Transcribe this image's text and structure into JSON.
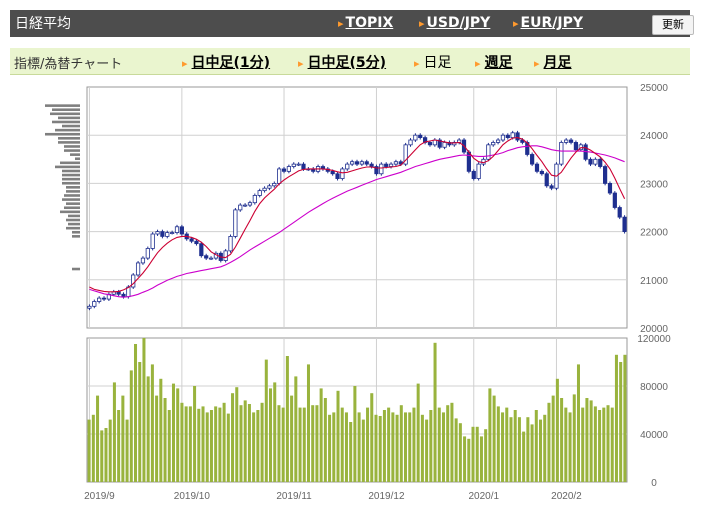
{
  "header": {
    "title": "日経平均",
    "links": [
      "TOPIX",
      "USD/JPY",
      "EUR/JPY"
    ],
    "refresh_label": "更新"
  },
  "tabs": {
    "label": "指標/為替チャート",
    "items": [
      {
        "label": "日中足(1分)",
        "active": false
      },
      {
        "label": "日中足(5分)",
        "active": false
      },
      {
        "label": "日足",
        "active": true
      },
      {
        "label": "週足",
        "active": false
      },
      {
        "label": "月足",
        "active": false
      }
    ]
  },
  "colors": {
    "accent": "#ff9a2e",
    "up_candle": "#ffffff",
    "down_candle": "#1f2f8f",
    "ma_short": "#cc0033",
    "ma_long": "#cc00cc",
    "volume_bar": "#99b33d",
    "volume_profile": "#7f7f7f"
  },
  "chart_data": [
    {
      "type": "candlestick",
      "title": "",
      "ylim": [
        20000,
        25000
      ],
      "yticks": [
        20000,
        21000,
        22000,
        23000,
        24000,
        25000
      ],
      "xticks": [
        {
          "label": "2019/9",
          "index": 0
        },
        {
          "label": "2019/10",
          "index": 19
        },
        {
          "label": "2019/11",
          "index": 40
        },
        {
          "label": "2019/12",
          "index": 59
        },
        {
          "label": "2020/1",
          "index": 79
        },
        {
          "label": "2020/2",
          "index": 96
        }
      ],
      "close": [
        20450,
        20550,
        20620,
        20600,
        20700,
        20750,
        20700,
        20650,
        20850,
        21100,
        21350,
        21450,
        21650,
        21950,
        22000,
        21900,
        21980,
        21980,
        22100,
        21950,
        21850,
        21800,
        21750,
        21500,
        21450,
        21450,
        21550,
        21400,
        21600,
        21900,
        22450,
        22550,
        22550,
        22600,
        22750,
        22850,
        22900,
        22950,
        23000,
        23300,
        23250,
        23350,
        23400,
        23400,
        23300,
        23300,
        23250,
        23350,
        23300,
        23250,
        23200,
        23100,
        23300,
        23400,
        23450,
        23400,
        23450,
        23400,
        23350,
        23200,
        23400,
        23350,
        23400,
        23450,
        23400,
        23800,
        23900,
        24000,
        23950,
        23850,
        23800,
        23900,
        23750,
        23850,
        23800,
        23850,
        23900,
        23650,
        23250,
        23100,
        23400,
        23500,
        23800,
        23850,
        23900,
        24000,
        23950,
        24050,
        23900,
        23850,
        23600,
        23400,
        23250,
        23200,
        22950,
        22900,
        23400,
        23850,
        23900,
        23850,
        23700,
        23800,
        23500,
        23400,
        23500,
        23350,
        23000,
        22800,
        22500,
        22300,
        22000
      ],
      "series": [
        {
          "name": "",
          "values": [
            20850,
            20800,
            20780,
            20760,
            20750,
            20750,
            20760,
            20790,
            20840,
            20920,
            21030,
            21140,
            21270,
            21420,
            21560,
            21670,
            21760,
            21830,
            21880,
            21900,
            21900,
            21880,
            21840,
            21780,
            21690,
            21580,
            21520,
            21470,
            21460,
            21530,
            21680,
            21860,
            22050,
            22230,
            22420,
            22580,
            22700,
            22790,
            22880,
            22990,
            23070,
            23140,
            23200,
            23260,
            23290,
            23300,
            23300,
            23300,
            23300,
            23290,
            23270,
            23240,
            23220,
            23230,
            23260,
            23290,
            23320,
            23340,
            23340,
            23320,
            23320,
            23330,
            23340,
            23350,
            23380,
            23480,
            23590,
            23700,
            23800,
            23860,
            23880,
            23900,
            23880,
            23860,
            23840,
            23840,
            23850,
            23780,
            23650,
            23520,
            23450,
            23430,
            23470,
            23560,
            23680,
            23800,
            23880,
            23940,
            23950,
            23920,
            23840,
            23720,
            23580,
            23450,
            23300,
            23170,
            23150,
            23230,
            23380,
            23530,
            23650,
            23740,
            23740,
            23690,
            23620,
            23550,
            23440,
            23300,
            23110,
            22890,
            22680
          ]
        },
        {
          "name": "",
          "values": [
            20800,
            20770,
            20740,
            20710,
            20690,
            20670,
            20650,
            20640,
            20650,
            20670,
            20700,
            20740,
            20780,
            20830,
            20890,
            20940,
            20990,
            21030,
            21070,
            21100,
            21130,
            21150,
            21170,
            21190,
            21210,
            21230,
            21250,
            21270,
            21310,
            21360,
            21420,
            21480,
            21550,
            21620,
            21680,
            21740,
            21800,
            21860,
            21920,
            21980,
            22050,
            22120,
            22190,
            22260,
            22330,
            22400,
            22460,
            22520,
            22580,
            22640,
            22690,
            22740,
            22790,
            22840,
            22880,
            22920,
            22960,
            23000,
            23040,
            23080,
            23110,
            23140,
            23170,
            23200,
            23230,
            23270,
            23310,
            23350,
            23380,
            23410,
            23440,
            23470,
            23500,
            23520,
            23540,
            23560,
            23580,
            23590,
            23580,
            23570,
            23560,
            23560,
            23570,
            23590,
            23610,
            23640,
            23680,
            23710,
            23740,
            23760,
            23770,
            23780,
            23780,
            23760,
            23730,
            23700,
            23680,
            23670,
            23670,
            23670,
            23670,
            23670,
            23660,
            23650,
            23630,
            23610,
            23590,
            23560,
            23530,
            23490,
            23450
          ]
        }
      ],
      "volume_profile": [
        -1,
        -1,
        -1,
        -1,
        35,
        28,
        30,
        22,
        28,
        18,
        25,
        35,
        22,
        22,
        16,
        16,
        10,
        5,
        20,
        25,
        18,
        18,
        18,
        18,
        14,
        14,
        16,
        18,
        14,
        16,
        20,
        12,
        14,
        12,
        14,
        8,
        8,
        0,
        0,
        -1,
        -1,
        -1,
        0,
        0,
        8,
        0,
        0,
        0,
        0,
        0,
        0,
        0,
        0,
        0,
        0,
        0,
        0,
        0,
        0
      ]
    },
    {
      "type": "bar",
      "title": "",
      "ylim": [
        0,
        120000
      ],
      "yticks": [
        0,
        40000,
        80000,
        120000
      ],
      "values": [
        52000,
        56000,
        72000,
        43000,
        45000,
        52000,
        83000,
        60000,
        72000,
        52000,
        93000,
        115000,
        100000,
        120000,
        88000,
        98000,
        72000,
        86000,
        70000,
        60000,
        82000,
        78000,
        66000,
        63000,
        63000,
        80000,
        61000,
        63000,
        58000,
        60000,
        63000,
        62000,
        66000,
        57000,
        74000,
        79000,
        64000,
        68000,
        65000,
        58000,
        60000,
        66000,
        102000,
        78000,
        83000,
        64000,
        62000,
        105000,
        72000,
        88000,
        62000,
        62000,
        98000,
        64000,
        64000,
        78000,
        70000,
        56000,
        58000,
        76000,
        62000,
        58000,
        50000,
        80000,
        58000,
        52000,
        62000,
        74000,
        56000,
        55000,
        60000,
        62000,
        58000,
        56000,
        64000,
        58000,
        58000,
        62000,
        82000,
        56000,
        52000,
        60000,
        116000,
        62000,
        58000,
        64000,
        66000,
        53000,
        49000,
        38000,
        36000,
        46000,
        46000,
        38000,
        44000,
        78000,
        72000,
        63000,
        58000,
        62000,
        54000,
        60000,
        54000,
        42000,
        54000,
        48000,
        60000,
        52000,
        56000,
        66000,
        72000,
        86000,
        70000,
        62000,
        58000,
        73000,
        98000,
        62000,
        70000,
        68000,
        63000,
        60000,
        62000,
        64000,
        62000,
        106000,
        100000,
        106000
      ]
    }
  ]
}
